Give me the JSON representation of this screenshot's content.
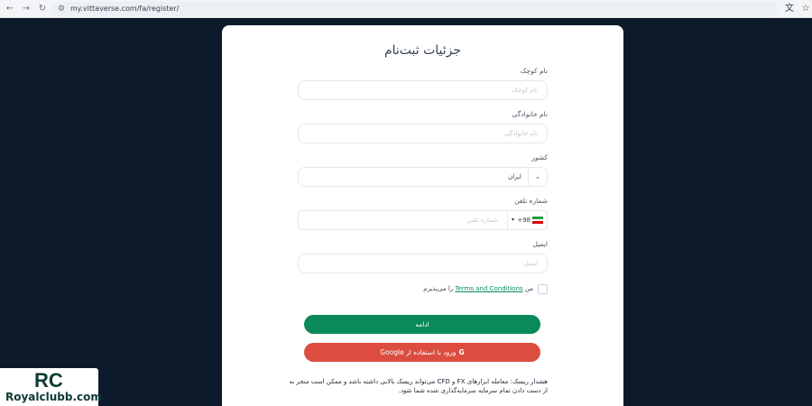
{
  "browser": {
    "url": "my.vittaverse.com/fa/register/",
    "back_icon": "←",
    "forward_icon": "→",
    "reload_icon": "↻",
    "site_info_icon": "⚙",
    "translate_icon": "文",
    "star_icon": "☆"
  },
  "form": {
    "title": "جزئیات ثبت‌نام",
    "first_name": {
      "label": "نام کوچک",
      "placeholder": "نام کوچک"
    },
    "last_name": {
      "label": "نام خانوادگی",
      "placeholder": "نام خانوادگی"
    },
    "country": {
      "label": "کشور",
      "value": "ایران",
      "chevron": "⌄"
    },
    "phone": {
      "label": "شماره تلفن",
      "dial_code": "+98",
      "caret": "▾",
      "placeholder": "شماره تلفن"
    },
    "email": {
      "label": "ایمیل",
      "placeholder": "ایمیل"
    },
    "terms": {
      "prefix": "من",
      "link": "Terms and Conditions",
      "suffix": "را می‌پذیرم"
    },
    "continue_label": "ادامه",
    "google": {
      "icon": "G",
      "label": "ورود با استفاده از Google"
    },
    "risk_warning": "هشدار ریسک: معامله ابزارهای FX و CFD می‌تواند ریسک بالایی داشته باشد و ممکن است منجر به از دست دادن تمام سرمایه سرمایه‌گذاری شده شما شود."
  },
  "logo": {
    "mark": "RC",
    "text": "Royalclubb.com"
  },
  "colors": {
    "background": "#0c1a2b",
    "primary": "#0a8a58",
    "google": "#dc4c3f",
    "link": "#0a8f5a"
  }
}
